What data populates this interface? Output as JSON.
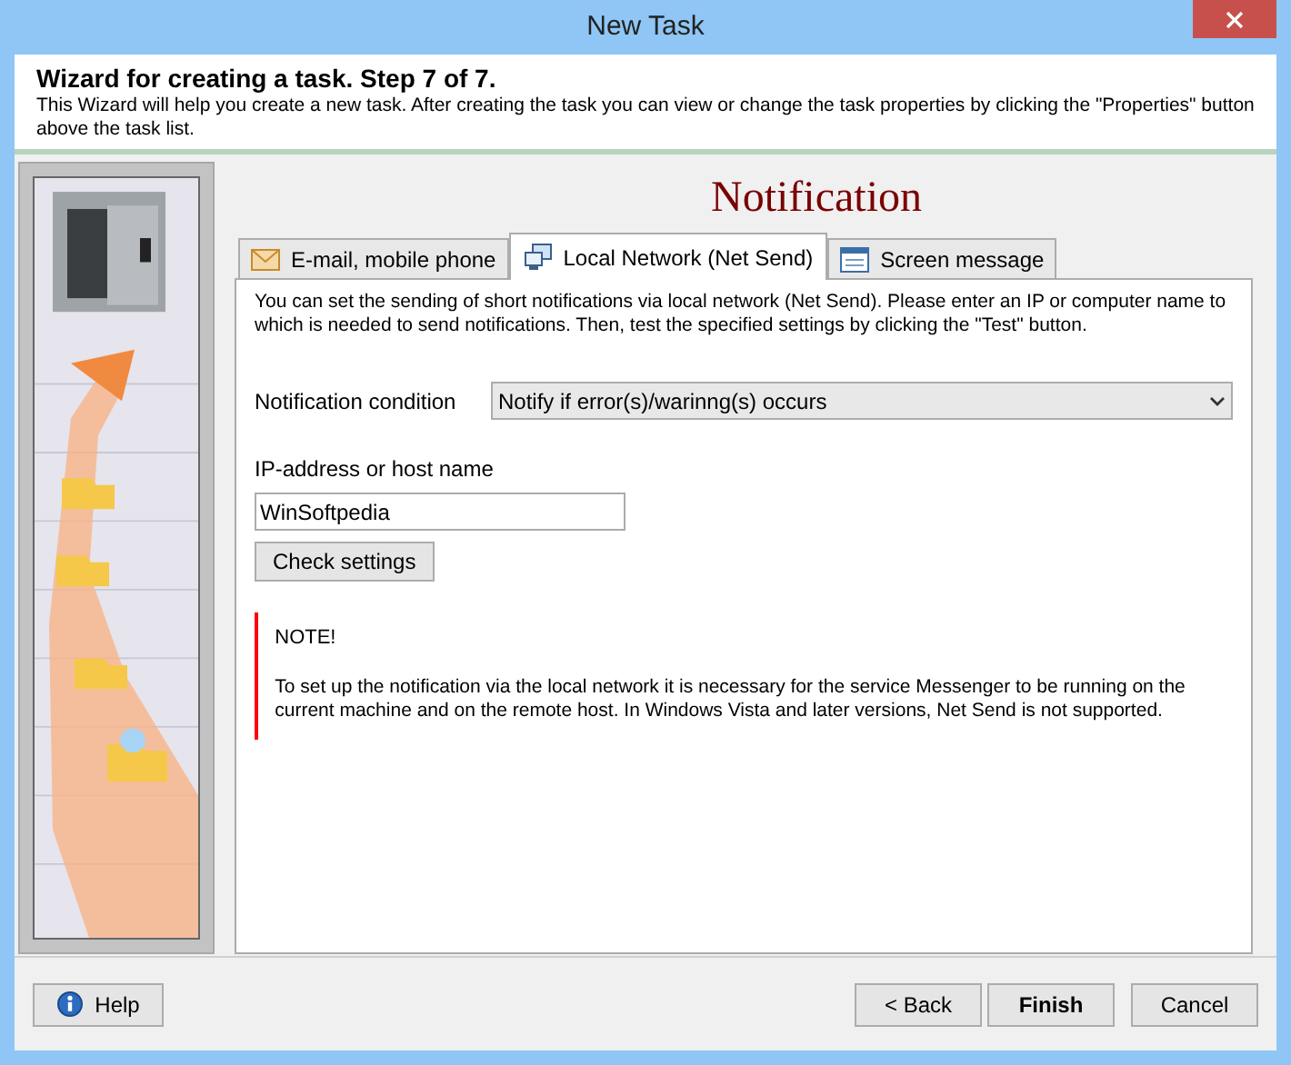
{
  "window": {
    "title": "New Task"
  },
  "header": {
    "title": "Wizard for creating a task. Step 7 of 7.",
    "description": "This Wizard will help you create a new task. After creating the task you can view or change the task properties by clicking the \"Properties\" button above the task list."
  },
  "page_title": "Notification",
  "tabs": [
    {
      "label": "E-mail, mobile phone",
      "kind": "envelope",
      "selected": false
    },
    {
      "label": "Local Network (Net Send)",
      "kind": "network",
      "selected": true
    },
    {
      "label": "Screen message",
      "kind": "window",
      "selected": false
    }
  ],
  "intro": "You can set the sending of short notifications via local network (Net Send). Please enter an IP or computer name to which is needed to send notifications. Then, test the specified settings by clicking the \"Test\" button.",
  "condition": {
    "label": "Notification condition",
    "value": "Notify if error(s)/warinng(s) occurs"
  },
  "host": {
    "label": "IP-address or host name",
    "value": "WinSoftpedia"
  },
  "check_button": "Check settings",
  "note": {
    "title": "NOTE!",
    "text": "To set up the notification via the local network it is necessary for the service Messenger to be running on the current machine and on the remote host. In Windows Vista and later versions, Net Send is not supported."
  },
  "buttons": {
    "help": "Help",
    "back": "< Back",
    "finish": "Finish",
    "cancel": "Cancel"
  }
}
